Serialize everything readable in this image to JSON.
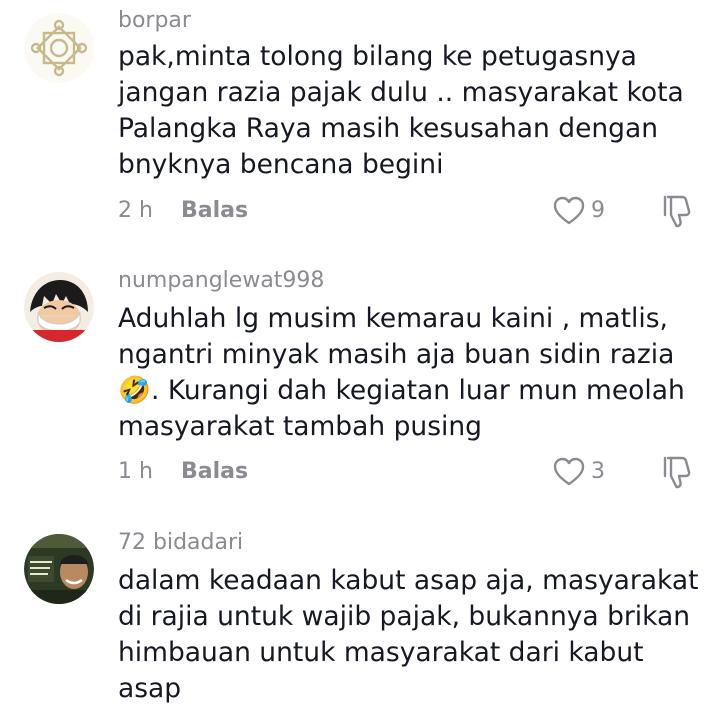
{
  "comments": [
    {
      "avatar": "ornament-logo-avatar",
      "username": "borpar",
      "text": "pak,minta tolong bilang ke petugasnya\njangan razia pajak dulu .. masyarakat kota\nPalangka Raya masih kesusahan dengan\nbnyknya bencana begini",
      "time": "2 h",
      "reply_label": "Balas",
      "likes": "9"
    },
    {
      "avatar": "cartoon-masked-boy-avatar",
      "username": "numpanglewat998",
      "text": "Aduhlah lg musim kemarau kaini , matlis,\nngantri minyak masih aja buan sidin razia\n🤣. Kurangi dah kegiatan luar mun meolah\nmasyarakat tambah pusing",
      "time": "1 h",
      "reply_label": "Balas",
      "likes": "3"
    },
    {
      "avatar": "meme-photo-avatar",
      "username": "72 bidadari",
      "text": "dalam keadaan kabut asap aja, masyarakat\ndi rajia untuk wajib pajak, bukannya brikan\nhimbauan untuk masyarakat dari kabut\nasap"
    }
  ],
  "colors": {
    "text": "#161823",
    "muted": "#8a8b91",
    "ornament": "#c9b98a"
  }
}
